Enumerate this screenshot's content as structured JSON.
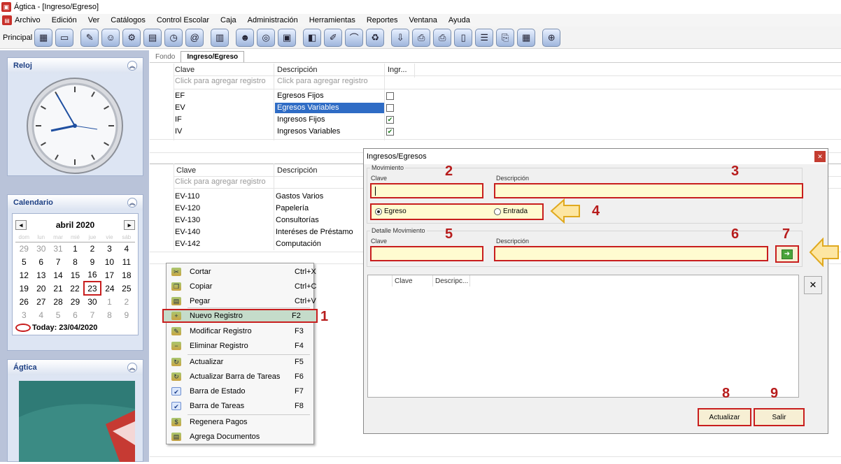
{
  "window": {
    "title": "Ágtica - [Ingreso/Egreso]"
  },
  "menu": [
    "Archivo",
    "Edición",
    "Ver",
    "Catálogos",
    "Control Escolar",
    "Caja",
    "Administración",
    "Herramientas",
    "Reportes",
    "Ventana",
    "Ayuda"
  ],
  "toolbar": {
    "label": "Principal"
  },
  "sidebar": {
    "clock_title": "Reloj",
    "calendar_title": "Calendario",
    "calendar_month": "abril 2020",
    "calendar_weeks": [
      [
        "29",
        "30",
        "31",
        "1",
        "2",
        "3",
        "4"
      ],
      [
        "5",
        "6",
        "7",
        "8",
        "9",
        "10",
        "11"
      ],
      [
        "12",
        "13",
        "14",
        "15",
        "16",
        "17",
        "18"
      ],
      [
        "19",
        "20",
        "21",
        "22",
        "23",
        "24",
        "25"
      ],
      [
        "26",
        "27",
        "28",
        "29",
        "30",
        "1",
        "2"
      ],
      [
        "3",
        "4",
        "5",
        "6",
        "7",
        "8",
        "9"
      ]
    ],
    "today_label": "Today: 23/04/2020",
    "agtica_title": "Ágtica"
  },
  "tabs": [
    "Fondo",
    "Ingreso/Egreso"
  ],
  "grid1": {
    "headers": {
      "clave": "Clave",
      "descripcion": "Descripción",
      "ingreso": "Ingr..."
    },
    "hint_clave": "Click para agregar registro",
    "hint_desc": "Click para agregar registro",
    "rows": [
      {
        "clave": "EF",
        "descripcion": "Egresos Fijos",
        "checked": false
      },
      {
        "clave": "EV",
        "descripcion": "Egresos Variables",
        "checked": false
      },
      {
        "clave": "IF",
        "descripcion": "Ingresos Fijos",
        "checked": true
      },
      {
        "clave": "IV",
        "descripcion": "Ingresos Variables",
        "checked": true
      }
    ]
  },
  "grid2": {
    "headers": {
      "clave": "Clave",
      "descripcion": "Descripción"
    },
    "hint_clave": "Click para agregar registro",
    "rows": [
      {
        "clave": "EV-110",
        "descripcion": "Gastos Varios"
      },
      {
        "clave": "EV-120",
        "descripcion": "Papelería"
      },
      {
        "clave": "EV-130",
        "descripcion": "Consultorías"
      },
      {
        "clave": "EV-140",
        "descripcion": "Interéses de Préstamo"
      },
      {
        "clave": "EV-142",
        "descripcion": "Computación"
      }
    ]
  },
  "context_menu": [
    {
      "label": "Cortar",
      "shortcut": "Ctrl+X"
    },
    {
      "label": "Copiar",
      "shortcut": "Ctrl+C"
    },
    {
      "label": "Pegar",
      "shortcut": "Ctrl+V"
    },
    {
      "label": "Nuevo Registro",
      "shortcut": "F2"
    },
    {
      "label": "Modificar Registro",
      "shortcut": "F3"
    },
    {
      "label": "Eliminar Registro",
      "shortcut": "F4"
    },
    {
      "label": "Actualizar",
      "shortcut": "F5"
    },
    {
      "label": "Actualizar Barra de Tareas",
      "shortcut": "F6"
    },
    {
      "label": "Barra de Estado",
      "shortcut": "F7"
    },
    {
      "label": "Barra de Tareas",
      "shortcut": "F8"
    },
    {
      "label": "Regenera Pagos",
      "shortcut": ""
    },
    {
      "label": "Agrega Documentos",
      "shortcut": ""
    }
  ],
  "dialog": {
    "title": "Ingresos/Egresos",
    "movimiento_group": "Movimiento",
    "clave_label": "Clave",
    "descripcion_label": "Descripción",
    "radio_egreso": "Egreso",
    "radio_entrada": "Entrada",
    "detalle_group": "Detalle Movimiento",
    "detalle_clave_label": "Clave",
    "detalle_descripcion_label": "Descripción",
    "grid_col_clave": "Clave",
    "grid_col_desc": "Descripc...",
    "btn_actualizar": "Actualizar",
    "btn_salir": "Salir",
    "close_glyph": "✕"
  },
  "annotations": [
    "1",
    "2",
    "3",
    "4",
    "5",
    "6",
    "7",
    "8",
    "9"
  ],
  "colors": {
    "accent_red": "#c81e1e",
    "input_yellow": "#fffbd0",
    "selection_blue": "#2f6cc5",
    "sidebar_bg": "#b9c3d9"
  }
}
